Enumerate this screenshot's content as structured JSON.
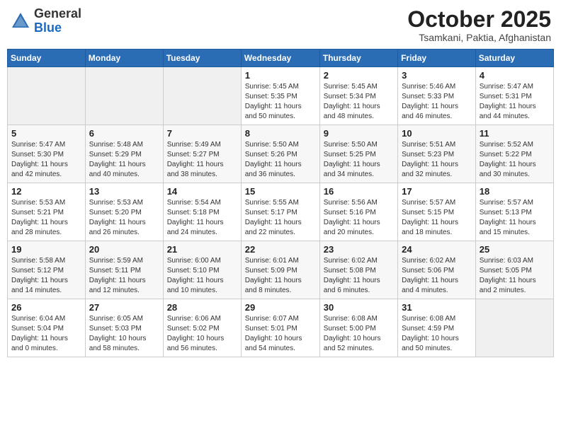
{
  "header": {
    "logo": {
      "text_general": "General",
      "text_blue": "Blue"
    },
    "title": "October 2025",
    "subtitle": "Tsamkani, Paktia, Afghanistan"
  },
  "weekdays": [
    "Sunday",
    "Monday",
    "Tuesday",
    "Wednesday",
    "Thursday",
    "Friday",
    "Saturday"
  ],
  "weeks": [
    [
      {
        "day": "",
        "info": ""
      },
      {
        "day": "",
        "info": ""
      },
      {
        "day": "",
        "info": ""
      },
      {
        "day": "1",
        "info": "Sunrise: 5:45 AM\nSunset: 5:35 PM\nDaylight: 11 hours\nand 50 minutes."
      },
      {
        "day": "2",
        "info": "Sunrise: 5:45 AM\nSunset: 5:34 PM\nDaylight: 11 hours\nand 48 minutes."
      },
      {
        "day": "3",
        "info": "Sunrise: 5:46 AM\nSunset: 5:33 PM\nDaylight: 11 hours\nand 46 minutes."
      },
      {
        "day": "4",
        "info": "Sunrise: 5:47 AM\nSunset: 5:31 PM\nDaylight: 11 hours\nand 44 minutes."
      }
    ],
    [
      {
        "day": "5",
        "info": "Sunrise: 5:47 AM\nSunset: 5:30 PM\nDaylight: 11 hours\nand 42 minutes."
      },
      {
        "day": "6",
        "info": "Sunrise: 5:48 AM\nSunset: 5:29 PM\nDaylight: 11 hours\nand 40 minutes."
      },
      {
        "day": "7",
        "info": "Sunrise: 5:49 AM\nSunset: 5:27 PM\nDaylight: 11 hours\nand 38 minutes."
      },
      {
        "day": "8",
        "info": "Sunrise: 5:50 AM\nSunset: 5:26 PM\nDaylight: 11 hours\nand 36 minutes."
      },
      {
        "day": "9",
        "info": "Sunrise: 5:50 AM\nSunset: 5:25 PM\nDaylight: 11 hours\nand 34 minutes."
      },
      {
        "day": "10",
        "info": "Sunrise: 5:51 AM\nSunset: 5:23 PM\nDaylight: 11 hours\nand 32 minutes."
      },
      {
        "day": "11",
        "info": "Sunrise: 5:52 AM\nSunset: 5:22 PM\nDaylight: 11 hours\nand 30 minutes."
      }
    ],
    [
      {
        "day": "12",
        "info": "Sunrise: 5:53 AM\nSunset: 5:21 PM\nDaylight: 11 hours\nand 28 minutes."
      },
      {
        "day": "13",
        "info": "Sunrise: 5:53 AM\nSunset: 5:20 PM\nDaylight: 11 hours\nand 26 minutes."
      },
      {
        "day": "14",
        "info": "Sunrise: 5:54 AM\nSunset: 5:18 PM\nDaylight: 11 hours\nand 24 minutes."
      },
      {
        "day": "15",
        "info": "Sunrise: 5:55 AM\nSunset: 5:17 PM\nDaylight: 11 hours\nand 22 minutes."
      },
      {
        "day": "16",
        "info": "Sunrise: 5:56 AM\nSunset: 5:16 PM\nDaylight: 11 hours\nand 20 minutes."
      },
      {
        "day": "17",
        "info": "Sunrise: 5:57 AM\nSunset: 5:15 PM\nDaylight: 11 hours\nand 18 minutes."
      },
      {
        "day": "18",
        "info": "Sunrise: 5:57 AM\nSunset: 5:13 PM\nDaylight: 11 hours\nand 15 minutes."
      }
    ],
    [
      {
        "day": "19",
        "info": "Sunrise: 5:58 AM\nSunset: 5:12 PM\nDaylight: 11 hours\nand 14 minutes."
      },
      {
        "day": "20",
        "info": "Sunrise: 5:59 AM\nSunset: 5:11 PM\nDaylight: 11 hours\nand 12 minutes."
      },
      {
        "day": "21",
        "info": "Sunrise: 6:00 AM\nSunset: 5:10 PM\nDaylight: 11 hours\nand 10 minutes."
      },
      {
        "day": "22",
        "info": "Sunrise: 6:01 AM\nSunset: 5:09 PM\nDaylight: 11 hours\nand 8 minutes."
      },
      {
        "day": "23",
        "info": "Sunrise: 6:02 AM\nSunset: 5:08 PM\nDaylight: 11 hours\nand 6 minutes."
      },
      {
        "day": "24",
        "info": "Sunrise: 6:02 AM\nSunset: 5:06 PM\nDaylight: 11 hours\nand 4 minutes."
      },
      {
        "day": "25",
        "info": "Sunrise: 6:03 AM\nSunset: 5:05 PM\nDaylight: 11 hours\nand 2 minutes."
      }
    ],
    [
      {
        "day": "26",
        "info": "Sunrise: 6:04 AM\nSunset: 5:04 PM\nDaylight: 11 hours\nand 0 minutes."
      },
      {
        "day": "27",
        "info": "Sunrise: 6:05 AM\nSunset: 5:03 PM\nDaylight: 10 hours\nand 58 minutes."
      },
      {
        "day": "28",
        "info": "Sunrise: 6:06 AM\nSunset: 5:02 PM\nDaylight: 10 hours\nand 56 minutes."
      },
      {
        "day": "29",
        "info": "Sunrise: 6:07 AM\nSunset: 5:01 PM\nDaylight: 10 hours\nand 54 minutes."
      },
      {
        "day": "30",
        "info": "Sunrise: 6:08 AM\nSunset: 5:00 PM\nDaylight: 10 hours\nand 52 minutes."
      },
      {
        "day": "31",
        "info": "Sunrise: 6:08 AM\nSunset: 4:59 PM\nDaylight: 10 hours\nand 50 minutes."
      },
      {
        "day": "",
        "info": ""
      }
    ]
  ]
}
